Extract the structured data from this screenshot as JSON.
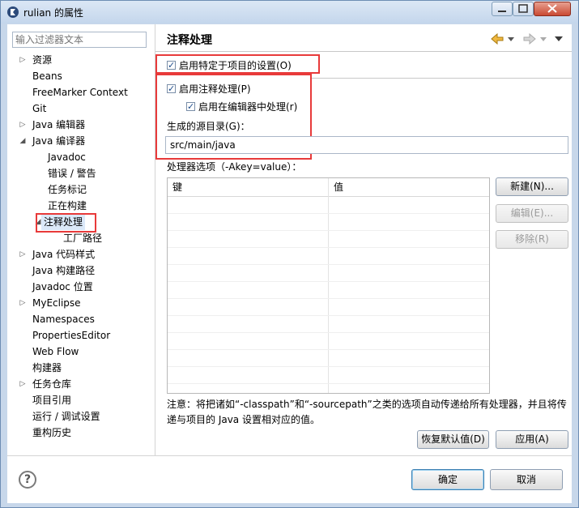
{
  "window": {
    "title": "rulian 的属性",
    "icon": "eclipse-project-icon"
  },
  "left_panel": {
    "filter_placeholder": "输入过滤器文本",
    "tree": [
      {
        "label": "资源",
        "expandable": true
      },
      {
        "label": "Beans",
        "expandable": false
      },
      {
        "label": "FreeMarker Context",
        "expandable": false
      },
      {
        "label": "Git",
        "expandable": false
      },
      {
        "label": "Java 编辑器",
        "expandable": true
      },
      {
        "label": "Java 编译器",
        "expandable": true,
        "expanded": true
      },
      {
        "label": "Javadoc",
        "expandable": false
      },
      {
        "label": "错误 / 警告",
        "expandable": false
      },
      {
        "label": "任务标记",
        "expandable": false
      },
      {
        "label": "正在构建",
        "expandable": false
      },
      {
        "label": "注释处理",
        "expandable": true,
        "expanded": true,
        "selected": true
      },
      {
        "label": "工厂路径",
        "expandable": false
      },
      {
        "label": "Java 代码样式",
        "expandable": true
      },
      {
        "label": "Java 构建路径",
        "expandable": false
      },
      {
        "label": "Javadoc 位置",
        "expandable": false
      },
      {
        "label": "MyEclipse",
        "expandable": true
      },
      {
        "label": "Namespaces",
        "expandable": false
      },
      {
        "label": "PropertiesEditor",
        "expandable": false
      },
      {
        "label": "Web Flow",
        "expandable": false
      },
      {
        "label": "构建器",
        "expandable": false
      },
      {
        "label": "任务仓库",
        "expandable": true
      },
      {
        "label": "项目引用",
        "expandable": false
      },
      {
        "label": "运行 / 调试设置",
        "expandable": false
      },
      {
        "label": "重构历史",
        "expandable": false
      }
    ]
  },
  "panel": {
    "title": "注释处理",
    "enable_project_settings": {
      "label": "启用特定于项目的设置(O)",
      "checked": true
    },
    "enable_annotation_processing": {
      "label": "启用注释处理(P)",
      "checked": true
    },
    "enable_in_editor": {
      "label": "启用在编辑器中处理(r)",
      "checked": true
    },
    "generated_source_dir_label": "生成的源目录(G)：",
    "generated_source_dir_value": "src/main/java",
    "processor_options_label": "处理器选项（-Akey=value）：",
    "table": {
      "columns": [
        "键",
        "值"
      ]
    },
    "buttons": {
      "new": "新建(N)...",
      "edit": "编辑(E)...",
      "remove": "移除(R)"
    },
    "note": "注意：将把诸如“-classpath”和“-sourcepath”之类的选项自动传递给所有处理器，并且将传递与项目的 Java 设置相对应的值。",
    "restore_defaults": "恢复默认值(D)",
    "apply": "应用(A)"
  },
  "footer": {
    "ok": "确定",
    "cancel": "取消"
  },
  "colors": {
    "highlight_border": "#e83a3a",
    "selection": "#dbe9f9",
    "title_bar": "#c4d6ec"
  }
}
